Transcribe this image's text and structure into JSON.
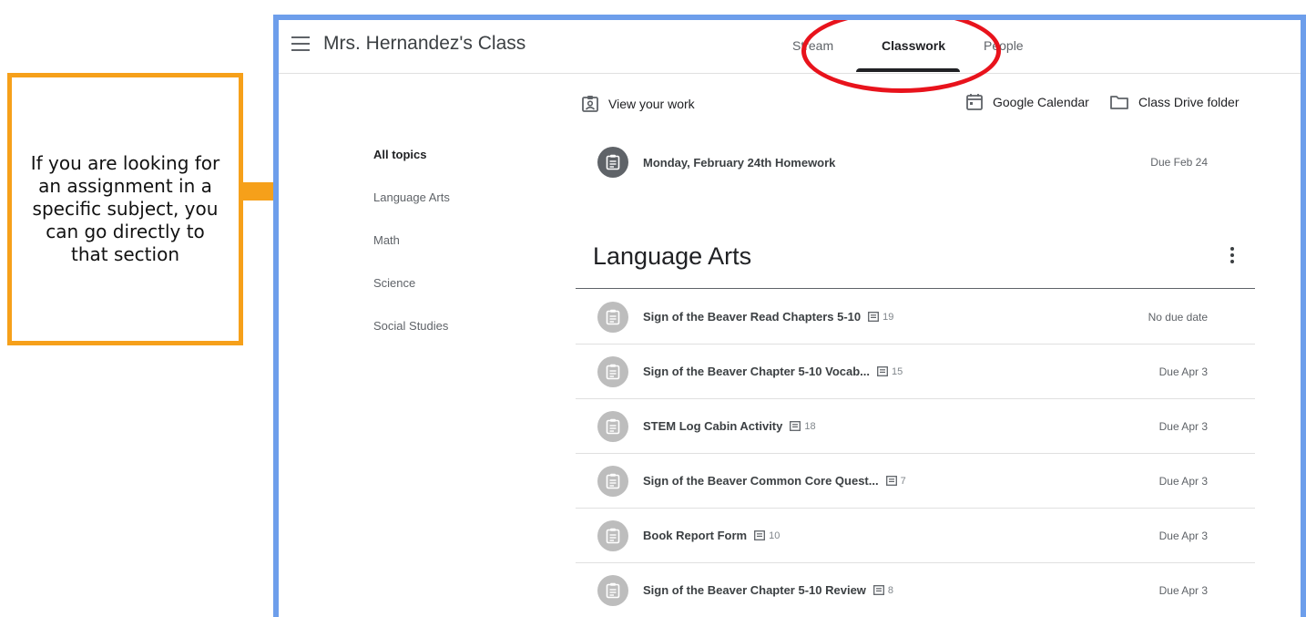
{
  "callout": {
    "text": "If you are looking for an assignment in a specific subject, you can go directly to that section",
    "border_color": "#f6a01a",
    "arrow_color": "#f6a01a"
  },
  "frame_color": "#6d9eeb",
  "highlight_color": "#e8131c",
  "header": {
    "menu_icon": "hamburger-icon",
    "class_title": "Mrs. Hernandez's Class",
    "tabs": [
      {
        "label": "Stream",
        "active": false
      },
      {
        "label": "Classwork",
        "active": true
      },
      {
        "label": "People",
        "active": false
      }
    ]
  },
  "actions": {
    "view_work": "View your work",
    "calendar": "Google Calendar",
    "drive": "Class Drive folder"
  },
  "topics": [
    "All topics",
    "Language Arts",
    "Math",
    "Science",
    "Social Studies"
  ],
  "pinned_assignment": {
    "title": "Monday, February 24th Homework",
    "due": "Due Feb 24"
  },
  "section": {
    "title": "Language Arts",
    "assignments": [
      {
        "title": "Sign of the Beaver Read Chapters 5-10",
        "comments": "19",
        "due": "No due date"
      },
      {
        "title": "Sign of the Beaver Chapter 5-10 Vocab...",
        "comments": "15",
        "due": "Due Apr 3"
      },
      {
        "title": "STEM Log Cabin Activity",
        "comments": "18",
        "due": "Due Apr 3"
      },
      {
        "title": "Sign of the Beaver Common Core Quest...",
        "comments": "7",
        "due": "Due Apr 3"
      },
      {
        "title": "Book Report Form",
        "comments": "10",
        "due": "Due Apr 3"
      },
      {
        "title": "Sign of the Beaver Chapter 5-10 Review",
        "comments": "8",
        "due": "Due Apr 3"
      }
    ]
  }
}
